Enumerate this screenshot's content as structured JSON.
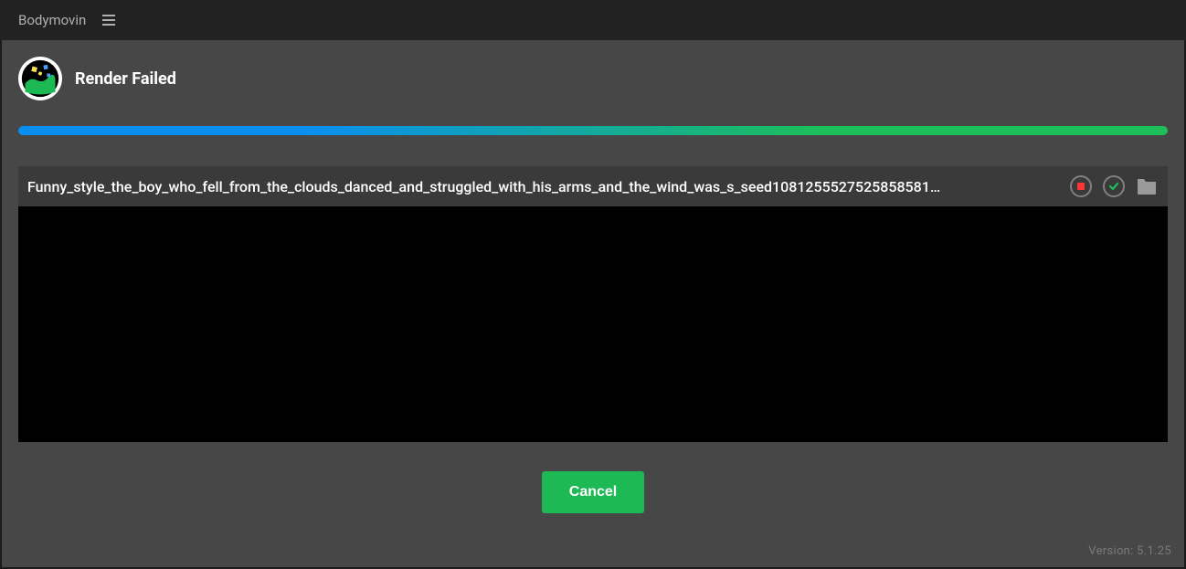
{
  "titlebar": {
    "appName": "Bodymovin"
  },
  "header": {
    "statusTitle": "Render Failed"
  },
  "item": {
    "filename": "Funny_style_the_boy_who_fell_from_the_clouds_danced_and_struggled_with_his_arms_and_the_wind_was_s_seed1081255527525858581…"
  },
  "footer": {
    "cancelLabel": "Cancel"
  },
  "versionText": "Version: 5.1.25",
  "colors": {
    "progressStart": "#0a8ff0",
    "progressEnd": "#1dbf5a",
    "accentGreen": "#1db954"
  }
}
